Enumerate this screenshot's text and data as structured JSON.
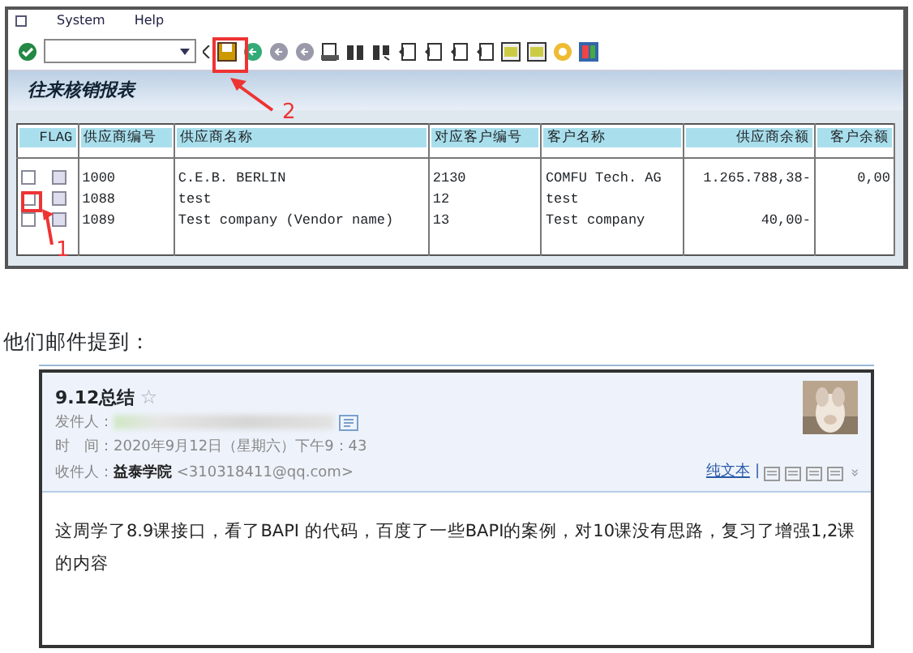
{
  "sap": {
    "menu": [
      "System",
      "Help"
    ],
    "title": "往来核销报表",
    "table": {
      "columns": [
        "FLAG",
        "供应商编号",
        "供应商名称",
        "对应客户编号",
        "客户名称",
        "供应商余额",
        "客户余额"
      ],
      "rows": [
        {
          "checked": false,
          "flag_checked": false,
          "cells": [
            "",
            "1000",
            "C.E.B. BERLIN",
            "2130",
            "COMFU Tech. AG",
            "1.265.788,38-",
            "0,00"
          ]
        },
        {
          "checked": false,
          "flag_checked": false,
          "cells": [
            "",
            "1088",
            "test",
            "12",
            "test",
            null,
            null
          ]
        },
        {
          "checked": false,
          "flag_checked": false,
          "cells": [
            "",
            "1089",
            "Test company (Vendor name)",
            "13",
            "Test company",
            "40,00-",
            null
          ]
        }
      ]
    }
  },
  "annotations": [
    {
      "label": "2"
    },
    {
      "label": "1"
    }
  ],
  "intro": "他们邮件提到：",
  "email": {
    "subject": "9.12总结",
    "star": "☆",
    "sender_label": "发件人：",
    "time": "时　间：2020年9月12日（星期六）下午9：43",
    "recipient": "收件人：**益泰学院** <310318411@qq.com>",
    "plain_text": "纯文本",
    "separator": "|",
    "more": "»",
    "body": "这周学了8.9课接口，看了BAPI 的代码，百度了一些BAPI的案例，对10课没有思路，复习了增强1,2课的内容"
  }
}
